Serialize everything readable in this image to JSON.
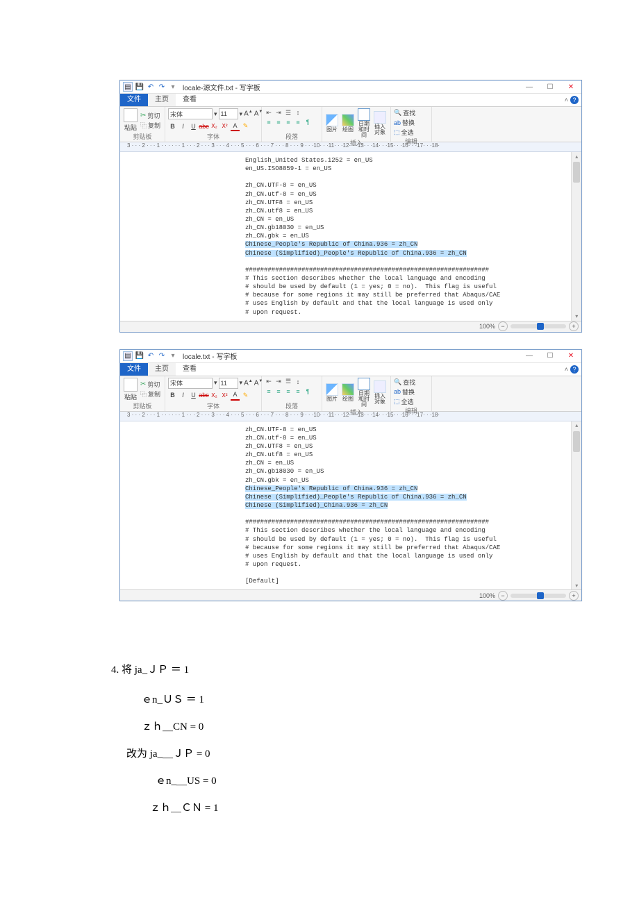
{
  "win1": {
    "title": "locale-源文件.txt - 写字板",
    "tabs": {
      "file": "文件",
      "home": "主页",
      "view": "查看"
    },
    "ribbon": {
      "clipboard": {
        "paste": "粘贴",
        "cut": "剪切",
        "copy": "复制",
        "label": "剪贴板"
      },
      "font": {
        "name": "宋体",
        "size": "11",
        "label": "字体"
      },
      "para": {
        "label": "段落"
      },
      "insert": {
        "picture": "图片",
        "paint": "绘图",
        "datetime": "日期和时间",
        "object": "插入对象",
        "label": "插入"
      },
      "edit": {
        "find": "查找",
        "replace": "替换",
        "selectall": "全选",
        "label": "编辑"
      }
    },
    "ruler": "3 · · · 2 · · · 1 · · · · · · 1 · · · 2 · · · 3 · · · 4 · · · 5 · · · 6 · · · 7 · · · 8 · · · 9 · · ·10· · ·11· · ·12· · ·13· · ·14· · ·15· · ·16· · ·17· · ·18·",
    "lines": [
      "English_United States.1252 = en_US",
      "en_US.ISO8859-1 = en_US",
      "",
      "zh_CN.UTF-8 = en_US",
      "zh_CN.utf-8 = en_US",
      "zh_CN.UTF8 = en_US",
      "zh_CN.utf8 = en_US",
      "zh_CN = en_US",
      "zh_CN.gb18030 = en_US",
      "zh_CN.gbk = en_US"
    ],
    "selected": [
      "Chinese_People's Republic of China.936 = zh_CN",
      "Chinese (Simplified)_People's Republic of China.936 = zh_CN"
    ],
    "lines2": [
      "",
      "#################################################################",
      "# This section describes whether the local language and encoding",
      "# should be used by default (1 = yes; 0 = no).  This flag is useful",
      "# because for some regions it may still be preferred that Abaqus/CAE",
      "# uses English by default and that the local language is used only",
      "# upon request."
    ],
    "zoom": "100%"
  },
  "win2": {
    "title": "locale.txt - 写字板",
    "lines": [
      "zh_CN.UTF-8 = en_US",
      "zh_CN.utf-8 = en_US",
      "zh_CN.UTF8 = en_US",
      "zh_CN.utf8 = en_US",
      "zh_CN = en_US",
      "zh_CN.gb18030 = en_US",
      "zh_CN.gbk = en_US"
    ],
    "selected": [
      "Chinese_People's Republic of China.936 = zh_CN",
      "Chinese (Simplified)_People's Republic of China.936 = zh_CN",
      "Chinese (Simplified)_China.936 = zh_CN"
    ],
    "lines2": [
      "",
      "#################################################################",
      "# This section describes whether the local language and encoding",
      "# should be used by default (1 = yes; 0 = no).  This flag is useful",
      "# because for some regions it may still be preferred that Abaqus/CAE",
      "# uses English by default and that the local language is used only",
      "# upon request.",
      "",
      "[Default]"
    ],
    "zoom": "100%"
  },
  "manual": {
    "l1": "4.  将 ja_ＪＰ ＝ 1",
    "l2": "ｅn_ＵＳ ＝ 1",
    "l3": "ｚｈ＿CN = 0",
    "l4": "改为  ja_＿ＪＰ = 0",
    "l5": "ｅn_＿US =  0",
    "l6": "ｚｈ＿ＣＮ =  1"
  }
}
